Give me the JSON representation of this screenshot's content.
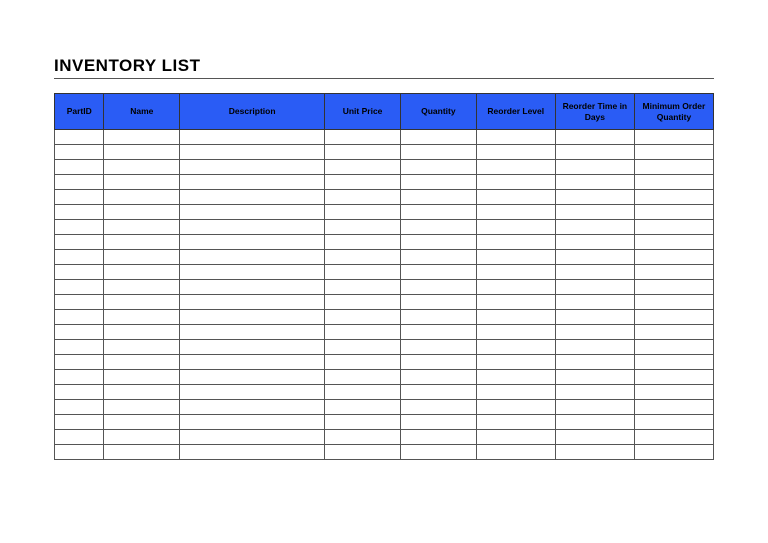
{
  "title": "INVENTORY LIST",
  "headers": {
    "partid": "PartID",
    "name": "Name",
    "description": "Description",
    "unitprice": "Unit Price",
    "quantity": "Quantity",
    "reorderlevel": "Reorder Level",
    "reordertime": "Reorder Time in Days",
    "minorder": "Minimum Order Quantity"
  },
  "rows": [
    {
      "partid": "",
      "name": "",
      "description": "",
      "unitprice": "",
      "quantity": "",
      "reorderlevel": "",
      "reordertime": "",
      "minorder": ""
    },
    {
      "partid": "",
      "name": "",
      "description": "",
      "unitprice": "",
      "quantity": "",
      "reorderlevel": "",
      "reordertime": "",
      "minorder": ""
    },
    {
      "partid": "",
      "name": "",
      "description": "",
      "unitprice": "",
      "quantity": "",
      "reorderlevel": "",
      "reordertime": "",
      "minorder": ""
    },
    {
      "partid": "",
      "name": "",
      "description": "",
      "unitprice": "",
      "quantity": "",
      "reorderlevel": "",
      "reordertime": "",
      "minorder": ""
    },
    {
      "partid": "",
      "name": "",
      "description": "",
      "unitprice": "",
      "quantity": "",
      "reorderlevel": "",
      "reordertime": "",
      "minorder": ""
    },
    {
      "partid": "",
      "name": "",
      "description": "",
      "unitprice": "",
      "quantity": "",
      "reorderlevel": "",
      "reordertime": "",
      "minorder": ""
    },
    {
      "partid": "",
      "name": "",
      "description": "",
      "unitprice": "",
      "quantity": "",
      "reorderlevel": "",
      "reordertime": "",
      "minorder": ""
    },
    {
      "partid": "",
      "name": "",
      "description": "",
      "unitprice": "",
      "quantity": "",
      "reorderlevel": "",
      "reordertime": "",
      "minorder": ""
    },
    {
      "partid": "",
      "name": "",
      "description": "",
      "unitprice": "",
      "quantity": "",
      "reorderlevel": "",
      "reordertime": "",
      "minorder": ""
    },
    {
      "partid": "",
      "name": "",
      "description": "",
      "unitprice": "",
      "quantity": "",
      "reorderlevel": "",
      "reordertime": "",
      "minorder": ""
    },
    {
      "partid": "",
      "name": "",
      "description": "",
      "unitprice": "",
      "quantity": "",
      "reorderlevel": "",
      "reordertime": "",
      "minorder": ""
    },
    {
      "partid": "",
      "name": "",
      "description": "",
      "unitprice": "",
      "quantity": "",
      "reorderlevel": "",
      "reordertime": "",
      "minorder": ""
    },
    {
      "partid": "",
      "name": "",
      "description": "",
      "unitprice": "",
      "quantity": "",
      "reorderlevel": "",
      "reordertime": "",
      "minorder": ""
    },
    {
      "partid": "",
      "name": "",
      "description": "",
      "unitprice": "",
      "quantity": "",
      "reorderlevel": "",
      "reordertime": "",
      "minorder": ""
    },
    {
      "partid": "",
      "name": "",
      "description": "",
      "unitprice": "",
      "quantity": "",
      "reorderlevel": "",
      "reordertime": "",
      "minorder": ""
    },
    {
      "partid": "",
      "name": "",
      "description": "",
      "unitprice": "",
      "quantity": "",
      "reorderlevel": "",
      "reordertime": "",
      "minorder": ""
    },
    {
      "partid": "",
      "name": "",
      "description": "",
      "unitprice": "",
      "quantity": "",
      "reorderlevel": "",
      "reordertime": "",
      "minorder": ""
    },
    {
      "partid": "",
      "name": "",
      "description": "",
      "unitprice": "",
      "quantity": "",
      "reorderlevel": "",
      "reordertime": "",
      "minorder": ""
    },
    {
      "partid": "",
      "name": "",
      "description": "",
      "unitprice": "",
      "quantity": "",
      "reorderlevel": "",
      "reordertime": "",
      "minorder": ""
    },
    {
      "partid": "",
      "name": "",
      "description": "",
      "unitprice": "",
      "quantity": "",
      "reorderlevel": "",
      "reordertime": "",
      "minorder": ""
    },
    {
      "partid": "",
      "name": "",
      "description": "",
      "unitprice": "",
      "quantity": "",
      "reorderlevel": "",
      "reordertime": "",
      "minorder": ""
    },
    {
      "partid": "",
      "name": "",
      "description": "",
      "unitprice": "",
      "quantity": "",
      "reorderlevel": "",
      "reordertime": "",
      "minorder": ""
    }
  ]
}
